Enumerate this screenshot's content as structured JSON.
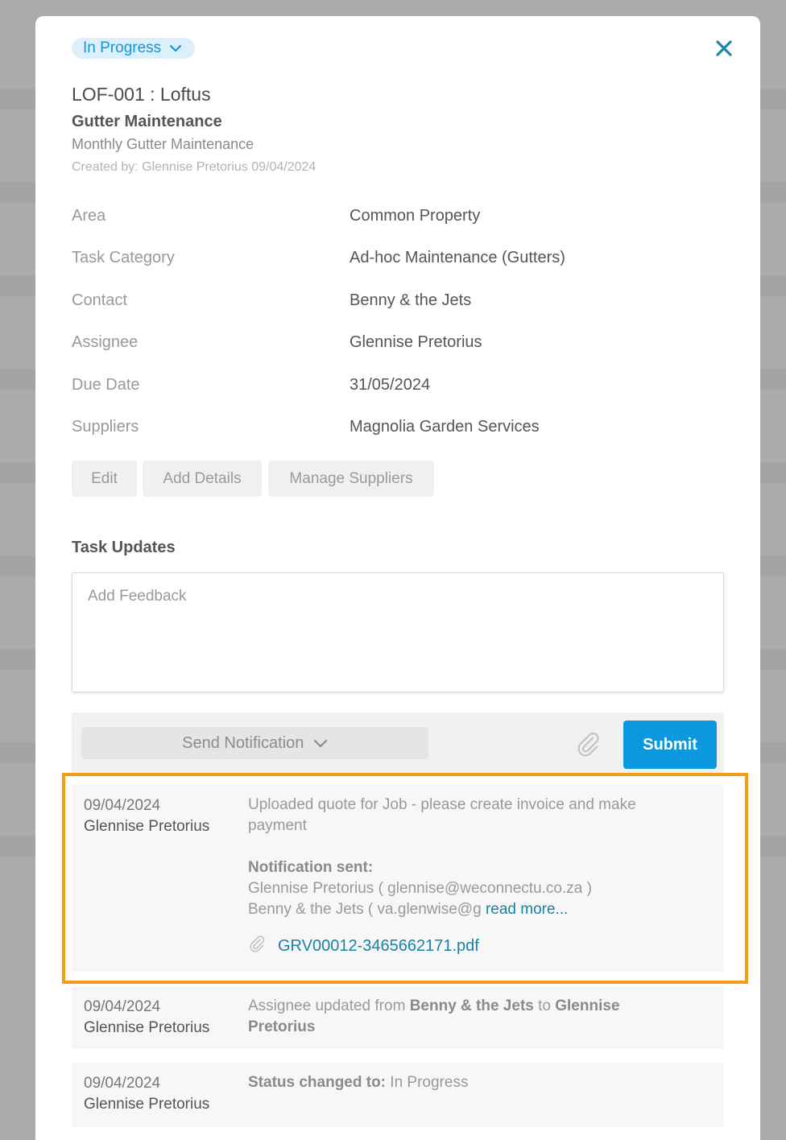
{
  "status": {
    "label": "In Progress",
    "icon": "chevron-down-icon"
  },
  "header": {
    "title": "LOF-001 : Loftus",
    "subtitle": "Gutter Maintenance",
    "description": "Monthly Gutter Maintenance",
    "created": "Created by: Glennise Pretorius 09/04/2024"
  },
  "details": [
    {
      "label": "Area",
      "value": "Common Property"
    },
    {
      "label": "Task Category",
      "value": "Ad-hoc Maintenance (Gutters)"
    },
    {
      "label": "Contact",
      "value": "Benny & the Jets"
    },
    {
      "label": "Assignee",
      "value": "Glennise Pretorius"
    },
    {
      "label": "Due Date",
      "value": "31/05/2024"
    },
    {
      "label": "Suppliers",
      "value": "Magnolia Garden Services"
    }
  ],
  "actions": {
    "edit": "Edit",
    "add_details": "Add Details",
    "manage_suppliers": "Manage Suppliers"
  },
  "task_updates": {
    "title": "Task Updates",
    "feedback_placeholder": "Add Feedback",
    "send_notification": "Send Notification",
    "submit": "Submit"
  },
  "updates": [
    {
      "date": "09/04/2024",
      "name": "Glennise Pretorius",
      "message": "Uploaded quote for Job - please create invoice and make payment",
      "notification_label": "Notification sent:",
      "recipient_1": "Glennise Pretorius ( glennise@weconnectu.co.za )",
      "recipient_2": "Benny & the Jets ( va.glenwise@g",
      "read_more": "read more...",
      "attachment": "GRV00012-3465662171.pdf"
    },
    {
      "date": "09/04/2024",
      "name": "Glennise Pretorius",
      "prefix": "Assignee updated from ",
      "from": "Benny & the Jets",
      "mid": " to ",
      "to": "Glennise Pretorius"
    },
    {
      "date": "09/04/2024",
      "name": "Glennise Pretorius",
      "label": "Status changed to:",
      "value": " In Progress"
    }
  ],
  "colors": {
    "accent": "#0c98de",
    "highlight": "#f59b15",
    "link": "#1a82a3",
    "pill_bg": "#dcf0fb"
  }
}
